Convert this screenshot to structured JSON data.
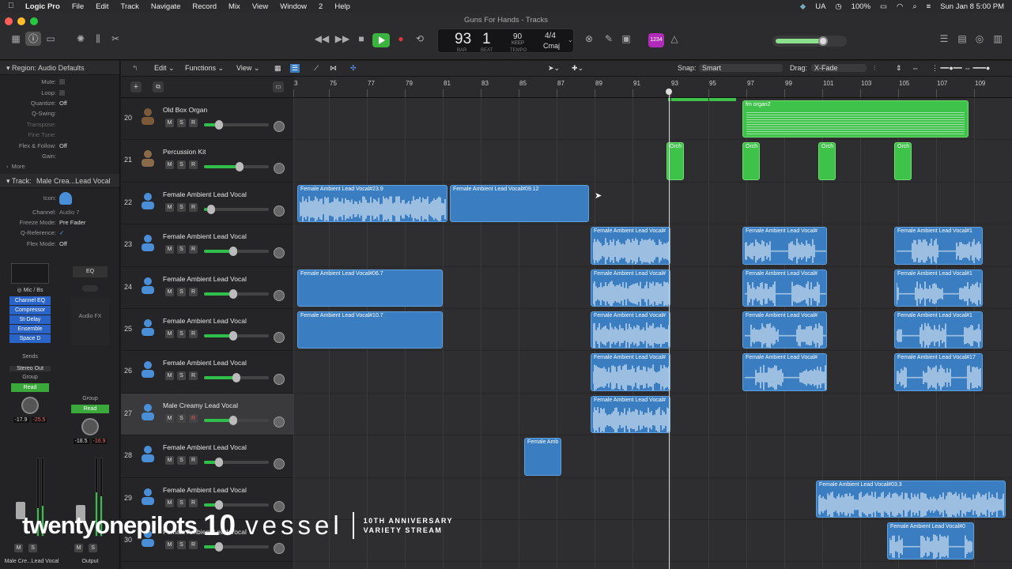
{
  "menubar": {
    "app": "Logic Pro",
    "items": [
      "File",
      "Edit",
      "Track",
      "Navigate",
      "Record",
      "Mix",
      "View",
      "Window",
      "2",
      "Help"
    ],
    "right": {
      "ua": "UA",
      "battery": "100%",
      "datetime": "Sun Jan 8  5:00 PM"
    }
  },
  "window": {
    "title": "Guns For Hands - Tracks"
  },
  "lcd": {
    "bar": "93",
    "beat": "1",
    "bar_label": "BAR",
    "beat_label": "BEAT",
    "tempo": "90",
    "keep_label": "KEEP",
    "tempo_label": "TEMPO",
    "signature": "4/4",
    "key": "Cmaj"
  },
  "counter_badge": "1234",
  "inspector": {
    "region_header": "Region: Audio Defaults",
    "region_rows": [
      {
        "k": "Mute:",
        "v": ""
      },
      {
        "k": "Loop:",
        "v": ""
      },
      {
        "k": "Quantize:",
        "v": "Off"
      },
      {
        "k": "Q-Swing:",
        "v": ""
      },
      {
        "k": "Transpose:",
        "v": ""
      },
      {
        "k": "Fine Tune:",
        "v": ""
      },
      {
        "k": "Flex & Follow:",
        "v": "Off"
      },
      {
        "k": "Gain:",
        "v": ""
      }
    ],
    "more": "More",
    "track_header": "Track:",
    "track_name": "Male Crea...Lead Vocal",
    "track_rows": [
      {
        "k": "Icon:",
        "v": ""
      },
      {
        "k": "Channel:",
        "v": "Audio 7"
      },
      {
        "k": "Freeze Mode:",
        "v": "Pre Fader"
      },
      {
        "k": "Q-Reference:",
        "v": "✓"
      },
      {
        "k": "Flex Mode:",
        "v": "Off"
      }
    ],
    "strip1": {
      "input": "Mic / Bs",
      "plugins": [
        "Channel EQ",
        "Compressor",
        "St-Delay",
        "Ensemble",
        "Space D"
      ],
      "sends": "Sends",
      "output": "Stereo Out",
      "group": "Group",
      "automation": "Read",
      "vol_a": "-17.9",
      "vol_b": "-25.5",
      "name": "Male Cre...Lead Vocal",
      "m": "M",
      "s": "S"
    },
    "strip2": {
      "eq": "EQ",
      "audio_fx": "Audio FX",
      "group": "Group",
      "automation": "Read",
      "vol_a": "-18.5",
      "vol_b": "-16.9",
      "name": "Output",
      "m": "M",
      "s": "S"
    }
  },
  "toolbar": {
    "edit": "Edit",
    "functions": "Functions",
    "view": "View",
    "snap_label": "Snap:",
    "snap_value": "Smart",
    "drag_label": "Drag:",
    "drag_value": "X-Fade"
  },
  "ruler": [
    "3",
    "75",
    "77",
    "79",
    "81",
    "83",
    "85",
    "87",
    "89",
    "91",
    "93",
    "95",
    "97",
    "99",
    "101",
    "103",
    "105",
    "107",
    "109"
  ],
  "tracks": [
    {
      "num": "20",
      "name": "Old Box Organ",
      "icon": "organ-icon",
      "fader": 0.2
    },
    {
      "num": "21",
      "name": "Percussion Kit",
      "icon": "drum-kit-icon",
      "fader": 0.55
    },
    {
      "num": "22",
      "name": "Female Ambient Lead Vocal",
      "icon": "singer-icon",
      "fader": 0.05
    },
    {
      "num": "23",
      "name": "Female Ambient Lead Vocal",
      "icon": "singer-icon",
      "fader": 0.45
    },
    {
      "num": "24",
      "name": "Female Ambient Lead Vocal",
      "icon": "singer-icon",
      "fader": 0.45
    },
    {
      "num": "25",
      "name": "Female Ambient Lead Vocal",
      "icon": "singer-icon",
      "fader": 0.45
    },
    {
      "num": "26",
      "name": "Female Ambient Lead Vocal",
      "icon": "singer-icon",
      "fader": 0.5
    },
    {
      "num": "27",
      "name": "Male Creamy Lead Vocal",
      "icon": "singer-icon",
      "fader": 0.45
    },
    {
      "num": "28",
      "name": "Female Ambient Lead Vocal",
      "icon": "singer-icon",
      "fader": 0.2
    },
    {
      "num": "29",
      "name": "Female Ambient Lead Vocal",
      "icon": "singer-icon",
      "fader": 0.2
    },
    {
      "num": "30",
      "name": "Female Ambient Lead Vocal",
      "icon": "singer-icon",
      "fader": 0.2
    }
  ],
  "track_buttons": {
    "m": "M",
    "s": "S",
    "r": "R"
  },
  "regions": {
    "r20a": "fm organ2",
    "orch": "Orch",
    "r22a": "Female Ambient Lead Vocal#23.9",
    "r22b": "Female Ambient Lead Vocal#09.12",
    "vocal_hash": "Female Ambient Lead Vocal#",
    "r23c": "Female Ambient Lead Vocal#1",
    "r24a": "Female Ambient Lead Vocal#06.7",
    "r25a": "Female Ambient Lead Vocal#10.7",
    "r26c": "Female Ambient Lead Vocal#17",
    "r28": "Female Amb",
    "r29": "Female Ambient Lead Vocal#03.3",
    "r30": "Female Ambient Lead Vocal#0"
  },
  "overlay": {
    "brand": "twentyonepilots",
    "ten": "10",
    "vessel": "vessel",
    "sub1": "10TH ANNIVERSARY",
    "sub2": "VARIETY STREAM"
  },
  "colors": {
    "audio_region": "#3a7dc0",
    "midi_region": "#3ec24a",
    "play": "#3bb33f",
    "record": "#e0353a"
  }
}
